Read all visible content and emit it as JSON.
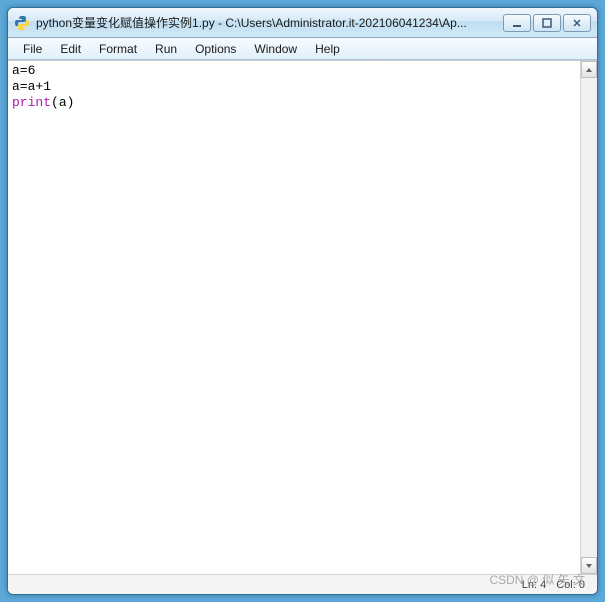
{
  "titlebar": {
    "title": "python变量变化赋值操作实例1.py - C:\\Users\\Administrator.it-202106041234\\Ap..."
  },
  "menubar": {
    "items": [
      "File",
      "Edit",
      "Format",
      "Run",
      "Options",
      "Window",
      "Help"
    ]
  },
  "editor": {
    "lines": [
      {
        "tokens": [
          {
            "t": "a=6",
            "c": ""
          }
        ]
      },
      {
        "tokens": [
          {
            "t": "a=a+1",
            "c": ""
          }
        ]
      },
      {
        "tokens": [
          {
            "t": "print",
            "c": "kw"
          },
          {
            "t": "(a)",
            "c": ""
          }
        ]
      }
    ]
  },
  "statusbar": {
    "line_label": "Ln: 4",
    "col_label": "Col: 0"
  },
  "watermark": "CSDN @ 似 矢 文"
}
